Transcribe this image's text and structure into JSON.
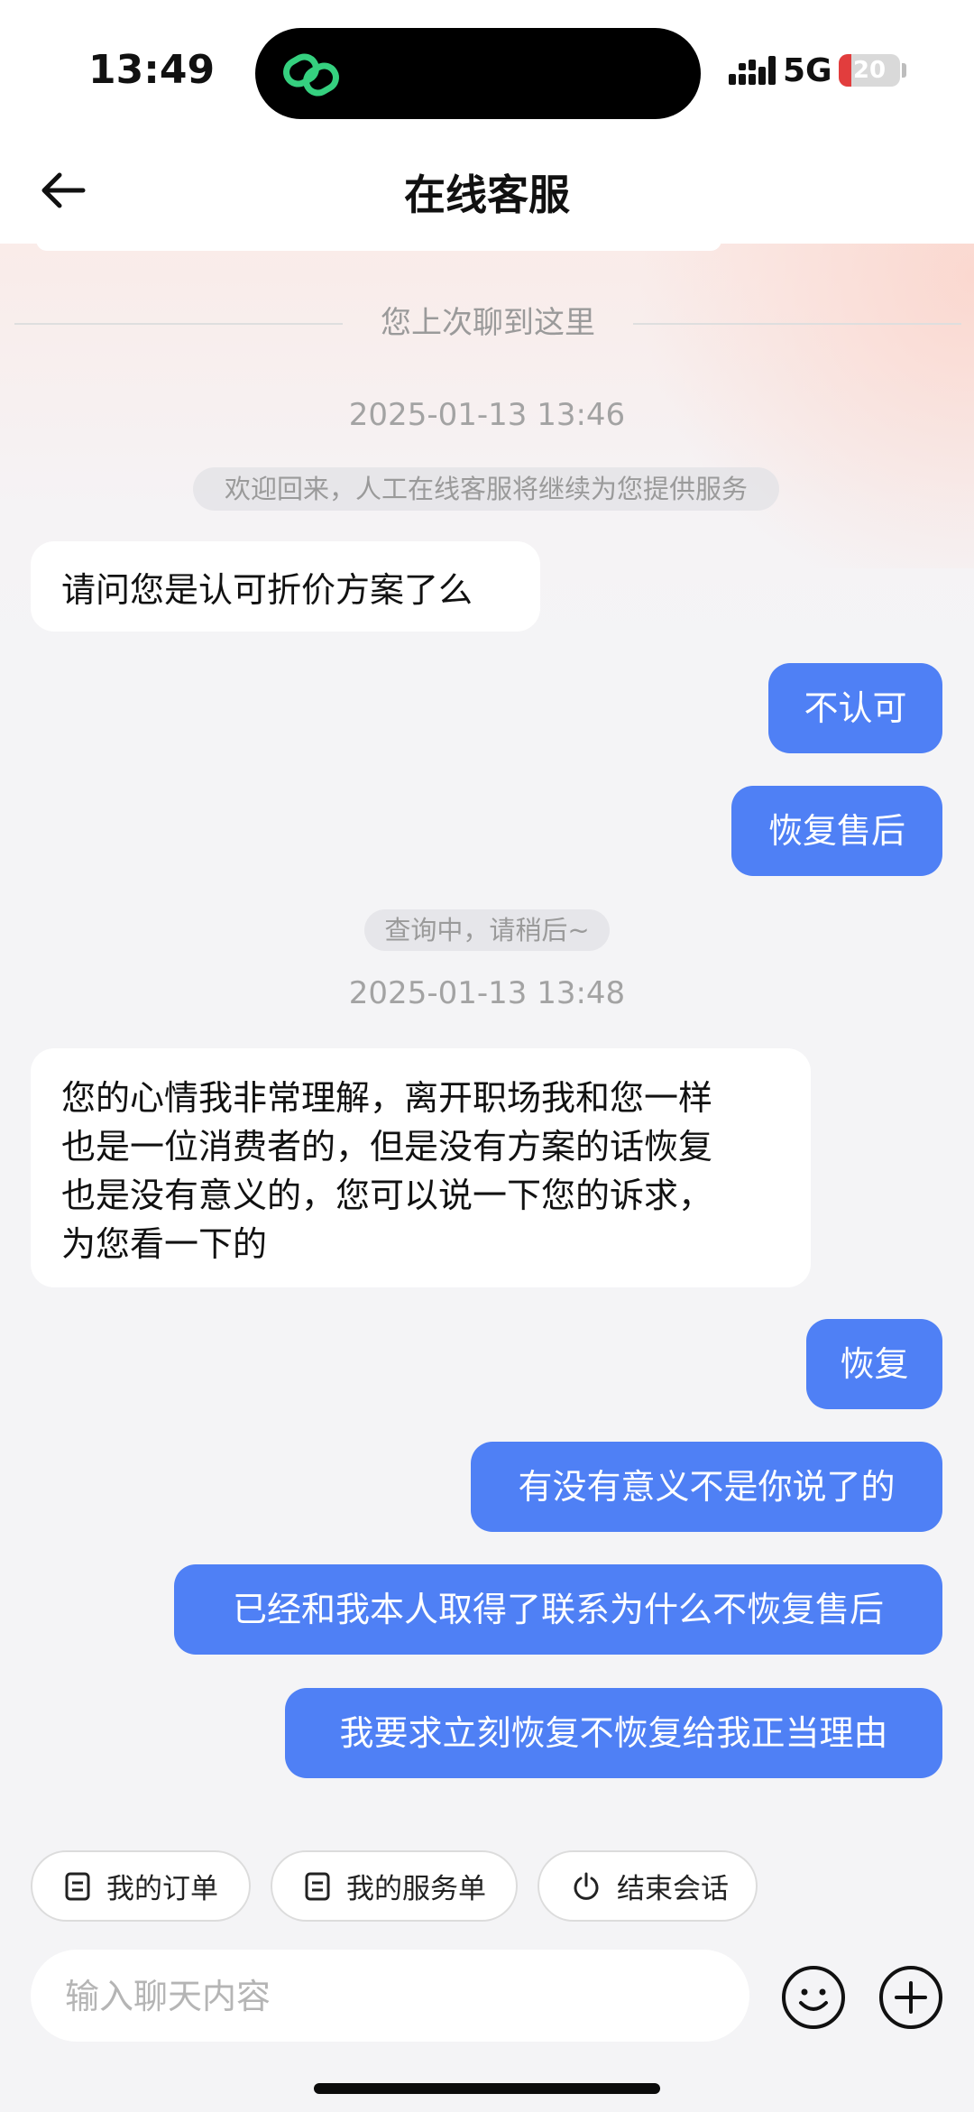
{
  "status_bar": {
    "time": "13:49",
    "network": "5G",
    "battery": "20",
    "battery_level": 0.2
  },
  "header": {
    "title": "在线客服"
  },
  "separator": {
    "label": "您上次聊到这里"
  },
  "chat": {
    "timestamp_1": "2025-01-13 13:46",
    "system_1": "欢迎回来，人工在线客服将继续为您提供服务",
    "agent_msg_1": "请问您是认可折价方案了么",
    "user_msg_1": "不认可",
    "user_msg_2": "恢复售后",
    "system_2": "查询中，请稍后~",
    "timestamp_2": "2025-01-13 13:48",
    "agent_msg_2_lines": [
      "您的心情我非常理解，离开职场我和您一样",
      "也是一位消费者的，但是没有方案的话恢复",
      "也是没有意义的，您可以说一下您的诉求，",
      "为您看一下的"
    ],
    "user_msg_3": "恢复",
    "user_msg_4": "有没有意义不是你说了的",
    "user_msg_5": "已经和我本人取得了联系为什么不恢复售后",
    "user_msg_6": "我要求立刻恢复不恢复给我正当理由"
  },
  "quick_actions": {
    "orders": "我的订单",
    "service_orders": "我的服务单",
    "end_session": "结束会话"
  },
  "input": {
    "placeholder": "输入聊天内容"
  },
  "colors": {
    "accent": "#4f80f5",
    "background": "#f4f4f6"
  }
}
